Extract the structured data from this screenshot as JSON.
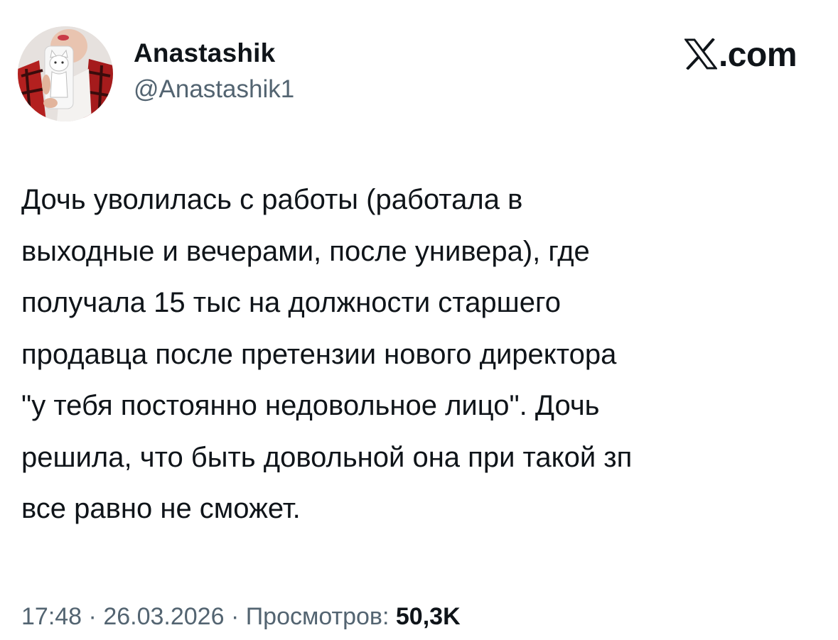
{
  "author": {
    "display_name": "Anastashik",
    "handle": "@Anastashik1",
    "avatar_icon": "profile-photo"
  },
  "site": {
    "logo_icon": "x-logo-icon",
    "domain_suffix": ".com"
  },
  "tweet": {
    "lines": [
      "Дочь уволилась с работы (работала в",
      "выходные и вечерами, после универа), где",
      "получала 15 тыс на должности старшего",
      "продавца после претензии нового директора",
      "\"у тебя постоянно недовольное лицо\". Дочь",
      "решила, что быть довольной она при такой зп",
      "все равно не сможет."
    ]
  },
  "meta": {
    "time": "17:48",
    "separator": "·",
    "date": "26.03.2026",
    "views_label": "Просмотров:",
    "views_count": "50,3K"
  },
  "colors": {
    "text": "#0f1419",
    "secondary_text": "#536471",
    "background": "#ffffff"
  }
}
